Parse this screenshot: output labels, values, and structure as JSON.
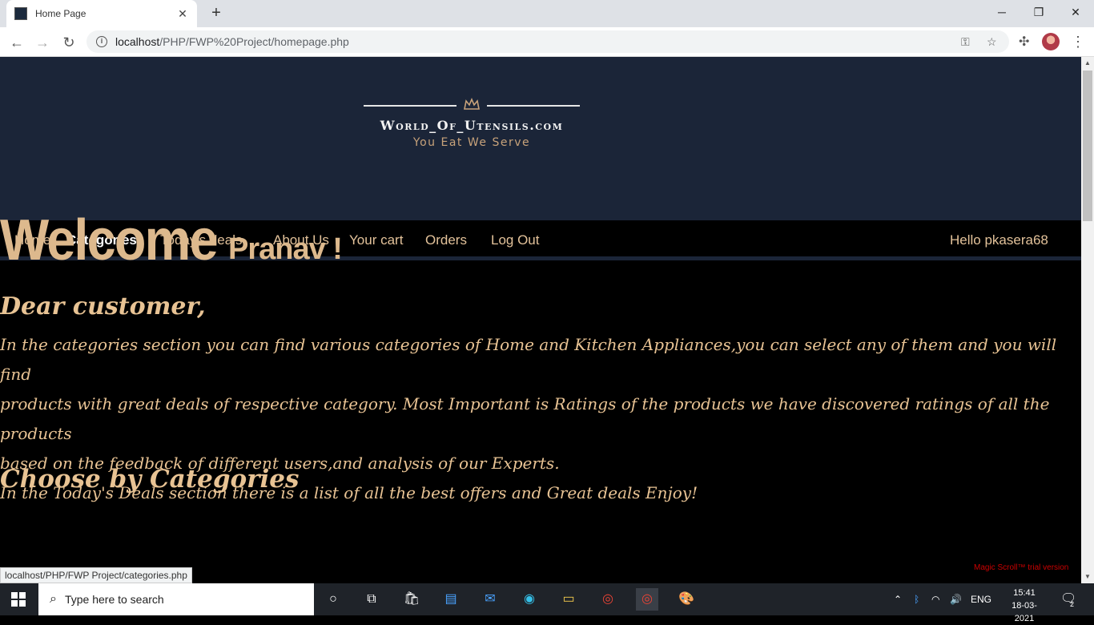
{
  "browser": {
    "tab_title": "Home Page",
    "url_host": "localhost",
    "url_path": "/PHP/FWP%20Project/homepage.php",
    "status_link": "localhost/PHP/FWP Project/categories.php"
  },
  "site": {
    "name": "World_Of_Utensils.com",
    "tagline": "You Eat We Serve"
  },
  "menu": {
    "items": [
      "Home",
      "Categories",
      "Today's deals",
      "About Us",
      "Your cart",
      "Orders",
      "Log Out"
    ],
    "greeting": "Hello pkasera68"
  },
  "content": {
    "welcome": "Welcome",
    "name": "Pranav !",
    "dear": "Dear customer,",
    "line1": "In the categories section you can find various categories of Home and Kitchen Appliances,you can select any of them and you will find",
    "line2": "products with great deals of respective category. Most Important is Ratings of the products we have discovered ratings of all the products",
    "line3": "based on the feedback of different users,and analysis of our Experts.",
    "line4": "In the Today's Deals section there is a list of all the best offers and Great deals Enjoy!",
    "choose": "Choose by Categories",
    "trial": "Magic Scroll™ trial version"
  },
  "taskbar": {
    "search_placeholder": "Type here to search",
    "lang": "ENG",
    "time": "15:41",
    "date": "18-03-2021",
    "notification_count": "2"
  },
  "colors": {
    "header_bg": "#1b2538",
    "accent_gold": "#ddb98d"
  }
}
